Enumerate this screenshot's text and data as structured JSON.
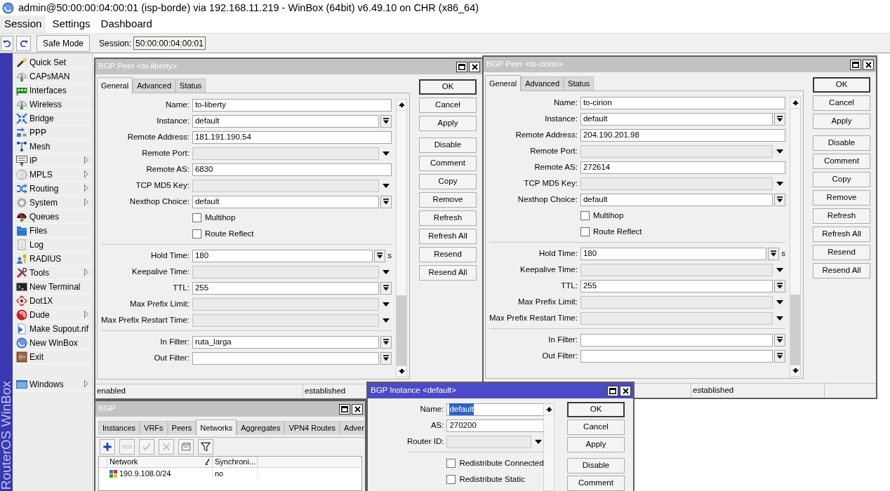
{
  "app_window": {
    "title": "admin@50:00:00:04:00:01 (isp-borde) via 192.168.11.219 - WinBox (64bit) v6.49.10 on CHR (x86_64)"
  },
  "menu_bar": [
    {
      "label": "Session",
      "highlighted": true
    },
    {
      "label": "Settings",
      "highlighted": false
    },
    {
      "label": "Dashboard",
      "highlighted": false
    }
  ],
  "toolbar": {
    "safe_mode": "Safe Mode",
    "session_label": "Session:",
    "session_value": "50:00:00:04:00:01"
  },
  "side_strip": {
    "text": "RouterOS WinBox"
  },
  "sidebar": {
    "items": [
      {
        "label": "Quick Set",
        "submenu": false
      },
      {
        "label": "CAPsMAN",
        "submenu": false
      },
      {
        "label": "Interfaces",
        "submenu": false
      },
      {
        "label": "Wireless",
        "submenu": false
      },
      {
        "label": "Bridge",
        "submenu": false
      },
      {
        "label": "PPP",
        "submenu": false
      },
      {
        "label": "Mesh",
        "submenu": false
      },
      {
        "label": "IP",
        "submenu": true
      },
      {
        "label": "MPLS",
        "submenu": true
      },
      {
        "label": "Routing",
        "submenu": true
      },
      {
        "label": "System",
        "submenu": true
      },
      {
        "label": "Queues",
        "submenu": false
      },
      {
        "label": "Files",
        "submenu": false
      },
      {
        "label": "Log",
        "submenu": false
      },
      {
        "label": "RADIUS",
        "submenu": false
      },
      {
        "label": "Tools",
        "submenu": true
      },
      {
        "label": "New Terminal",
        "submenu": false
      },
      {
        "label": "Dot1X",
        "submenu": false
      },
      {
        "label": "Dude",
        "submenu": true
      },
      {
        "label": "Make Supout.rif",
        "submenu": false
      },
      {
        "label": "New WinBox",
        "submenu": false
      },
      {
        "label": "Exit",
        "submenu": false
      }
    ],
    "bottom_items": [
      {
        "label": "Windows",
        "submenu": true
      }
    ]
  },
  "windows": [
    {
      "kind": "form",
      "title": "BGP Peer <to-liberty>",
      "active": false,
      "tabs": [
        {
          "label": "General",
          "selected": true
        },
        {
          "label": "Advanced",
          "selected": false
        },
        {
          "label": "Status",
          "selected": false
        }
      ],
      "sections": [
        [
          {
            "label": "Name:",
            "kind": "text",
            "value": "to-liberty"
          },
          {
            "label": "Instance:",
            "kind": "combo",
            "value": "default"
          },
          {
            "label": "Remote Address:",
            "kind": "text",
            "value": "181.191.190.54"
          },
          {
            "label": "Remote Port:",
            "kind": "unset"
          },
          {
            "label": "Remote AS:",
            "kind": "text",
            "value": "6830"
          },
          {
            "label": "TCP MD5 Key:",
            "kind": "unset"
          },
          {
            "label": "Nexthop Choice:",
            "kind": "combo",
            "value": "default"
          },
          {
            "label": "Multihop",
            "kind": "checkbox",
            "checked": false
          },
          {
            "label": "Route Reflect",
            "kind": "checkbox",
            "checked": false
          }
        ],
        [
          {
            "label": "Hold Time:",
            "kind": "combo",
            "value": "180",
            "unit": "s"
          },
          {
            "label": "Keepalive Time:",
            "kind": "unset"
          },
          {
            "label": "TTL:",
            "kind": "combo",
            "value": "255"
          },
          {
            "label": "Max Prefix Limit:",
            "kind": "unset"
          },
          {
            "label": "Max Prefix Restart Time:",
            "kind": "unset"
          }
        ],
        [
          {
            "label": "In Filter:",
            "kind": "combo",
            "value": "ruta_larga"
          },
          {
            "label": "Out Filter:",
            "kind": "combo"
          }
        ]
      ],
      "button_groups": [
        [
          {
            "label": "OK",
            "default": true
          },
          {
            "label": "Cancel",
            "default": false
          },
          {
            "label": "Apply",
            "default": false
          }
        ],
        [
          {
            "label": "Disable",
            "default": false
          },
          {
            "label": "Comment",
            "default": false
          },
          {
            "label": "Copy",
            "default": false
          },
          {
            "label": "Remove",
            "default": false
          },
          {
            "label": "Refresh",
            "default": false
          },
          {
            "label": "Refresh All",
            "default": false
          },
          {
            "label": "Resend",
            "default": false
          },
          {
            "label": "Resend All",
            "default": false
          }
        ]
      ],
      "status_bar": {
        "cell_1": "enabled",
        "cell_2": "established"
      }
    },
    {
      "kind": "form",
      "title": "BGP Peer <to-cirion>",
      "active": false,
      "tabs": [
        {
          "label": "General",
          "selected": true
        },
        {
          "label": "Advanced",
          "selected": false
        },
        {
          "label": "Status",
          "selected": false
        }
      ],
      "sections": [
        [
          {
            "label": "Name:",
            "kind": "text",
            "value": "to-cirion"
          },
          {
            "label": "Instance:",
            "kind": "combo",
            "value": "default"
          },
          {
            "label": "Remote Address:",
            "kind": "text",
            "value": "204.190.201.98"
          },
          {
            "label": "Remote Port:",
            "kind": "unset"
          },
          {
            "label": "Remote AS:",
            "kind": "text",
            "value": "272614"
          },
          {
            "label": "TCP MD5 Key:",
            "kind": "unset"
          },
          {
            "label": "Nexthop Choice:",
            "kind": "combo",
            "value": "default"
          },
          {
            "label": "Multihop",
            "kind": "checkbox",
            "checked": false
          },
          {
            "label": "Route Reflect",
            "kind": "checkbox",
            "checked": false
          }
        ],
        [
          {
            "label": "Hold Time:",
            "kind": "combo",
            "value": "180",
            "unit": "s"
          },
          {
            "label": "Keepalive Time:",
            "kind": "unset"
          },
          {
            "label": "TTL:",
            "kind": "combo",
            "value": "255"
          },
          {
            "label": "Max Prefix Limit:",
            "kind": "unset"
          },
          {
            "label": "Max Prefix Restart Time:",
            "kind": "unset"
          }
        ],
        [
          {
            "label": "In Filter:",
            "kind": "combo"
          },
          {
            "label": "Out Filter:",
            "kind": "combo"
          }
        ]
      ],
      "button_groups": [
        [
          {
            "label": "OK",
            "default": true
          },
          {
            "label": "Cancel",
            "default": false
          },
          {
            "label": "Apply",
            "default": false
          }
        ],
        [
          {
            "label": "Disable",
            "default": false
          },
          {
            "label": "Comment",
            "default": false
          },
          {
            "label": "Copy",
            "default": false
          },
          {
            "label": "Remove",
            "default": false
          },
          {
            "label": "Refresh",
            "default": false
          },
          {
            "label": "Refresh All",
            "default": false
          },
          {
            "label": "Resend",
            "default": false
          },
          {
            "label": "Resend All",
            "default": false
          }
        ]
      ],
      "status_bar": {
        "cell_2": "established"
      }
    },
    {
      "kind": "list",
      "title": "BGP",
      "active": false,
      "tabs": [
        {
          "label": "Instances",
          "selected": false
        },
        {
          "label": "VRFs",
          "selected": false
        },
        {
          "label": "Peers",
          "selected": false
        },
        {
          "label": "Networks",
          "selected": true
        },
        {
          "label": "Aggregates",
          "selected": false
        },
        {
          "label": "VPN4 Routes",
          "selected": false
        },
        {
          "label": "Adver",
          "selected": false
        }
      ],
      "tools": [
        {
          "disabled": false
        },
        {
          "disabled": true
        },
        {
          "disabled": true
        },
        {
          "disabled": true
        },
        {
          "disabled": false
        },
        {
          "disabled": false
        }
      ],
      "table": {
        "columns": [
          {
            "label": "Network",
            "sorted": true
          },
          {
            "label": "Synchroni...",
            "sorted": false
          }
        ],
        "rows": [
          {
            "cells": [
              "190.9.108.0/24",
              "no"
            ]
          }
        ]
      }
    },
    {
      "kind": "form",
      "title": "BGP Instance <default>",
      "active": true,
      "sections": [
        [
          {
            "label": "Name:",
            "kind": "text",
            "value": "default",
            "text_selected": true
          },
          {
            "label": "AS:",
            "kind": "text",
            "value": "270200",
            "text_selected": false
          },
          {
            "label": "Router ID:",
            "kind": "unset"
          }
        ],
        [
          {
            "label": "Redistribute Connected",
            "kind": "checkbox",
            "checked": false
          },
          {
            "label": "Redistribute Static",
            "kind": "checkbox",
            "checked": false
          }
        ]
      ],
      "button_groups": [
        [
          {
            "label": "OK",
            "default": true
          },
          {
            "label": "Cancel",
            "default": false
          },
          {
            "label": "Apply",
            "default": false
          }
        ],
        [
          {
            "label": "Disable",
            "default": false
          },
          {
            "label": "Comment",
            "default": false
          }
        ]
      ]
    }
  ]
}
